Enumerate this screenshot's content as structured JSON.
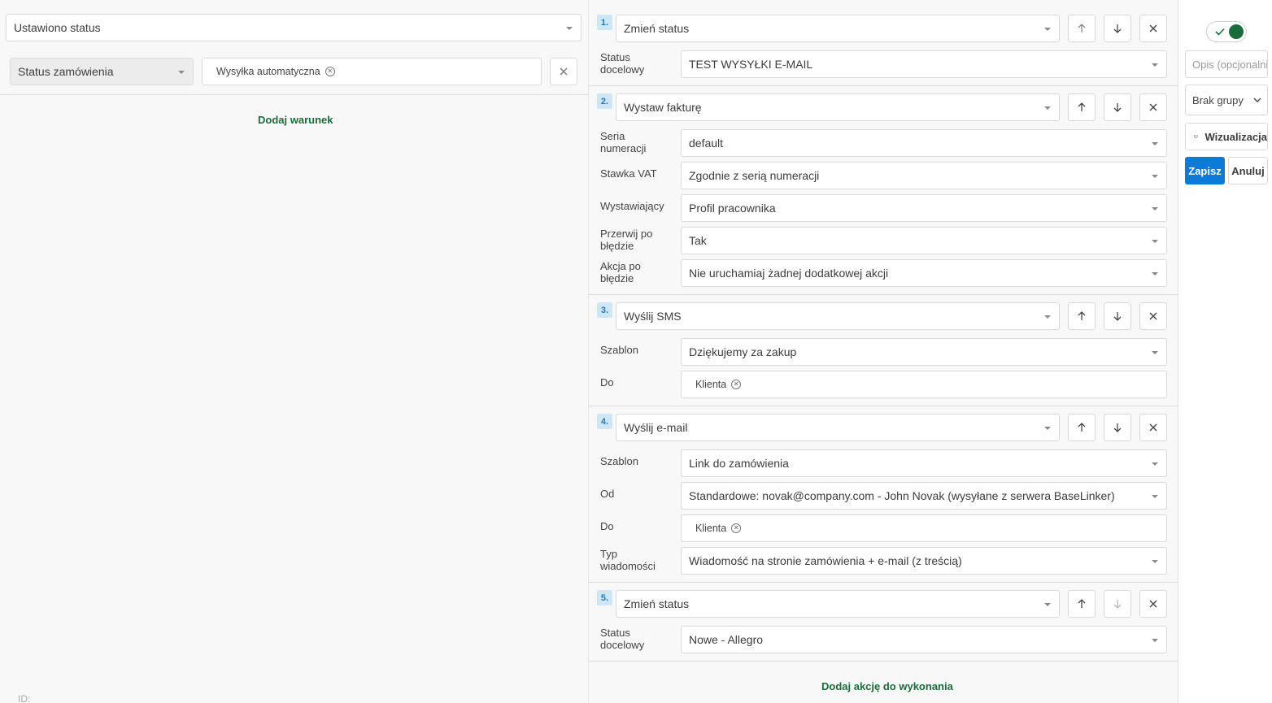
{
  "trigger": {
    "value": "Ustawiono status"
  },
  "condition": {
    "field": "Status zamówienia",
    "tag": "Wysyłka automatyczna"
  },
  "add_condition_label": "Dodaj warunek",
  "footer_id_label": "ID:",
  "actions": [
    {
      "number": "1.",
      "type": "Zmień status",
      "fields": [
        {
          "label": "Status docelowy",
          "value": "TEST WYSYŁKI E-MAIL"
        }
      ]
    },
    {
      "number": "2.",
      "type": "Wystaw fakturę",
      "fields": [
        {
          "label": "Seria numeracji",
          "value": "default"
        },
        {
          "label": "Stawka VAT",
          "value": "Zgodnie z serią numeracji"
        },
        {
          "label": "Wystawiający",
          "value": "Profil pracownika"
        },
        {
          "label": "Przerwij po błędzie",
          "value": "Tak"
        },
        {
          "label": "Akcja po błędzie",
          "value": "Nie uruchamiaj żadnej dodatkowej akcji"
        }
      ]
    },
    {
      "number": "3.",
      "type": "Wyślij SMS",
      "fields": [
        {
          "label": "Szablon",
          "value": "Dziękujemy za zakup"
        },
        {
          "label": "Do",
          "tag": "Klienta"
        }
      ]
    },
    {
      "number": "4.",
      "type": "Wyślij e-mail",
      "fields": [
        {
          "label": "Szablon",
          "value": "Link do zamówienia"
        },
        {
          "label": "Od",
          "value": "Standardowe: novak@company.com - John Novak (wysyłane z serwera BaseLinker)"
        },
        {
          "label": "Do",
          "tag": "Klienta"
        },
        {
          "label": "Typ wiadomości",
          "value": "Wiadomość na stronie zamówienia + e-mail (z treścią)"
        }
      ]
    },
    {
      "number": "5.",
      "type": "Zmień status",
      "fields": [
        {
          "label": "Status docelowy",
          "value": "Nowe - Allegro"
        }
      ]
    }
  ],
  "add_action_label": "Dodaj akcję do wykonania",
  "sidebar": {
    "enabled": true,
    "description_placeholder": "Opis (opcjonalnie)",
    "group_value": "Brak grupy",
    "visualization_label": "Wizualizacja",
    "save_label": "Zapisz",
    "cancel_label": "Anuluj"
  },
  "colors": {
    "accent_green": "#1c6b3b",
    "primary_blue": "#0d7ad9",
    "number_badge_bg": "#cfe6f7"
  }
}
